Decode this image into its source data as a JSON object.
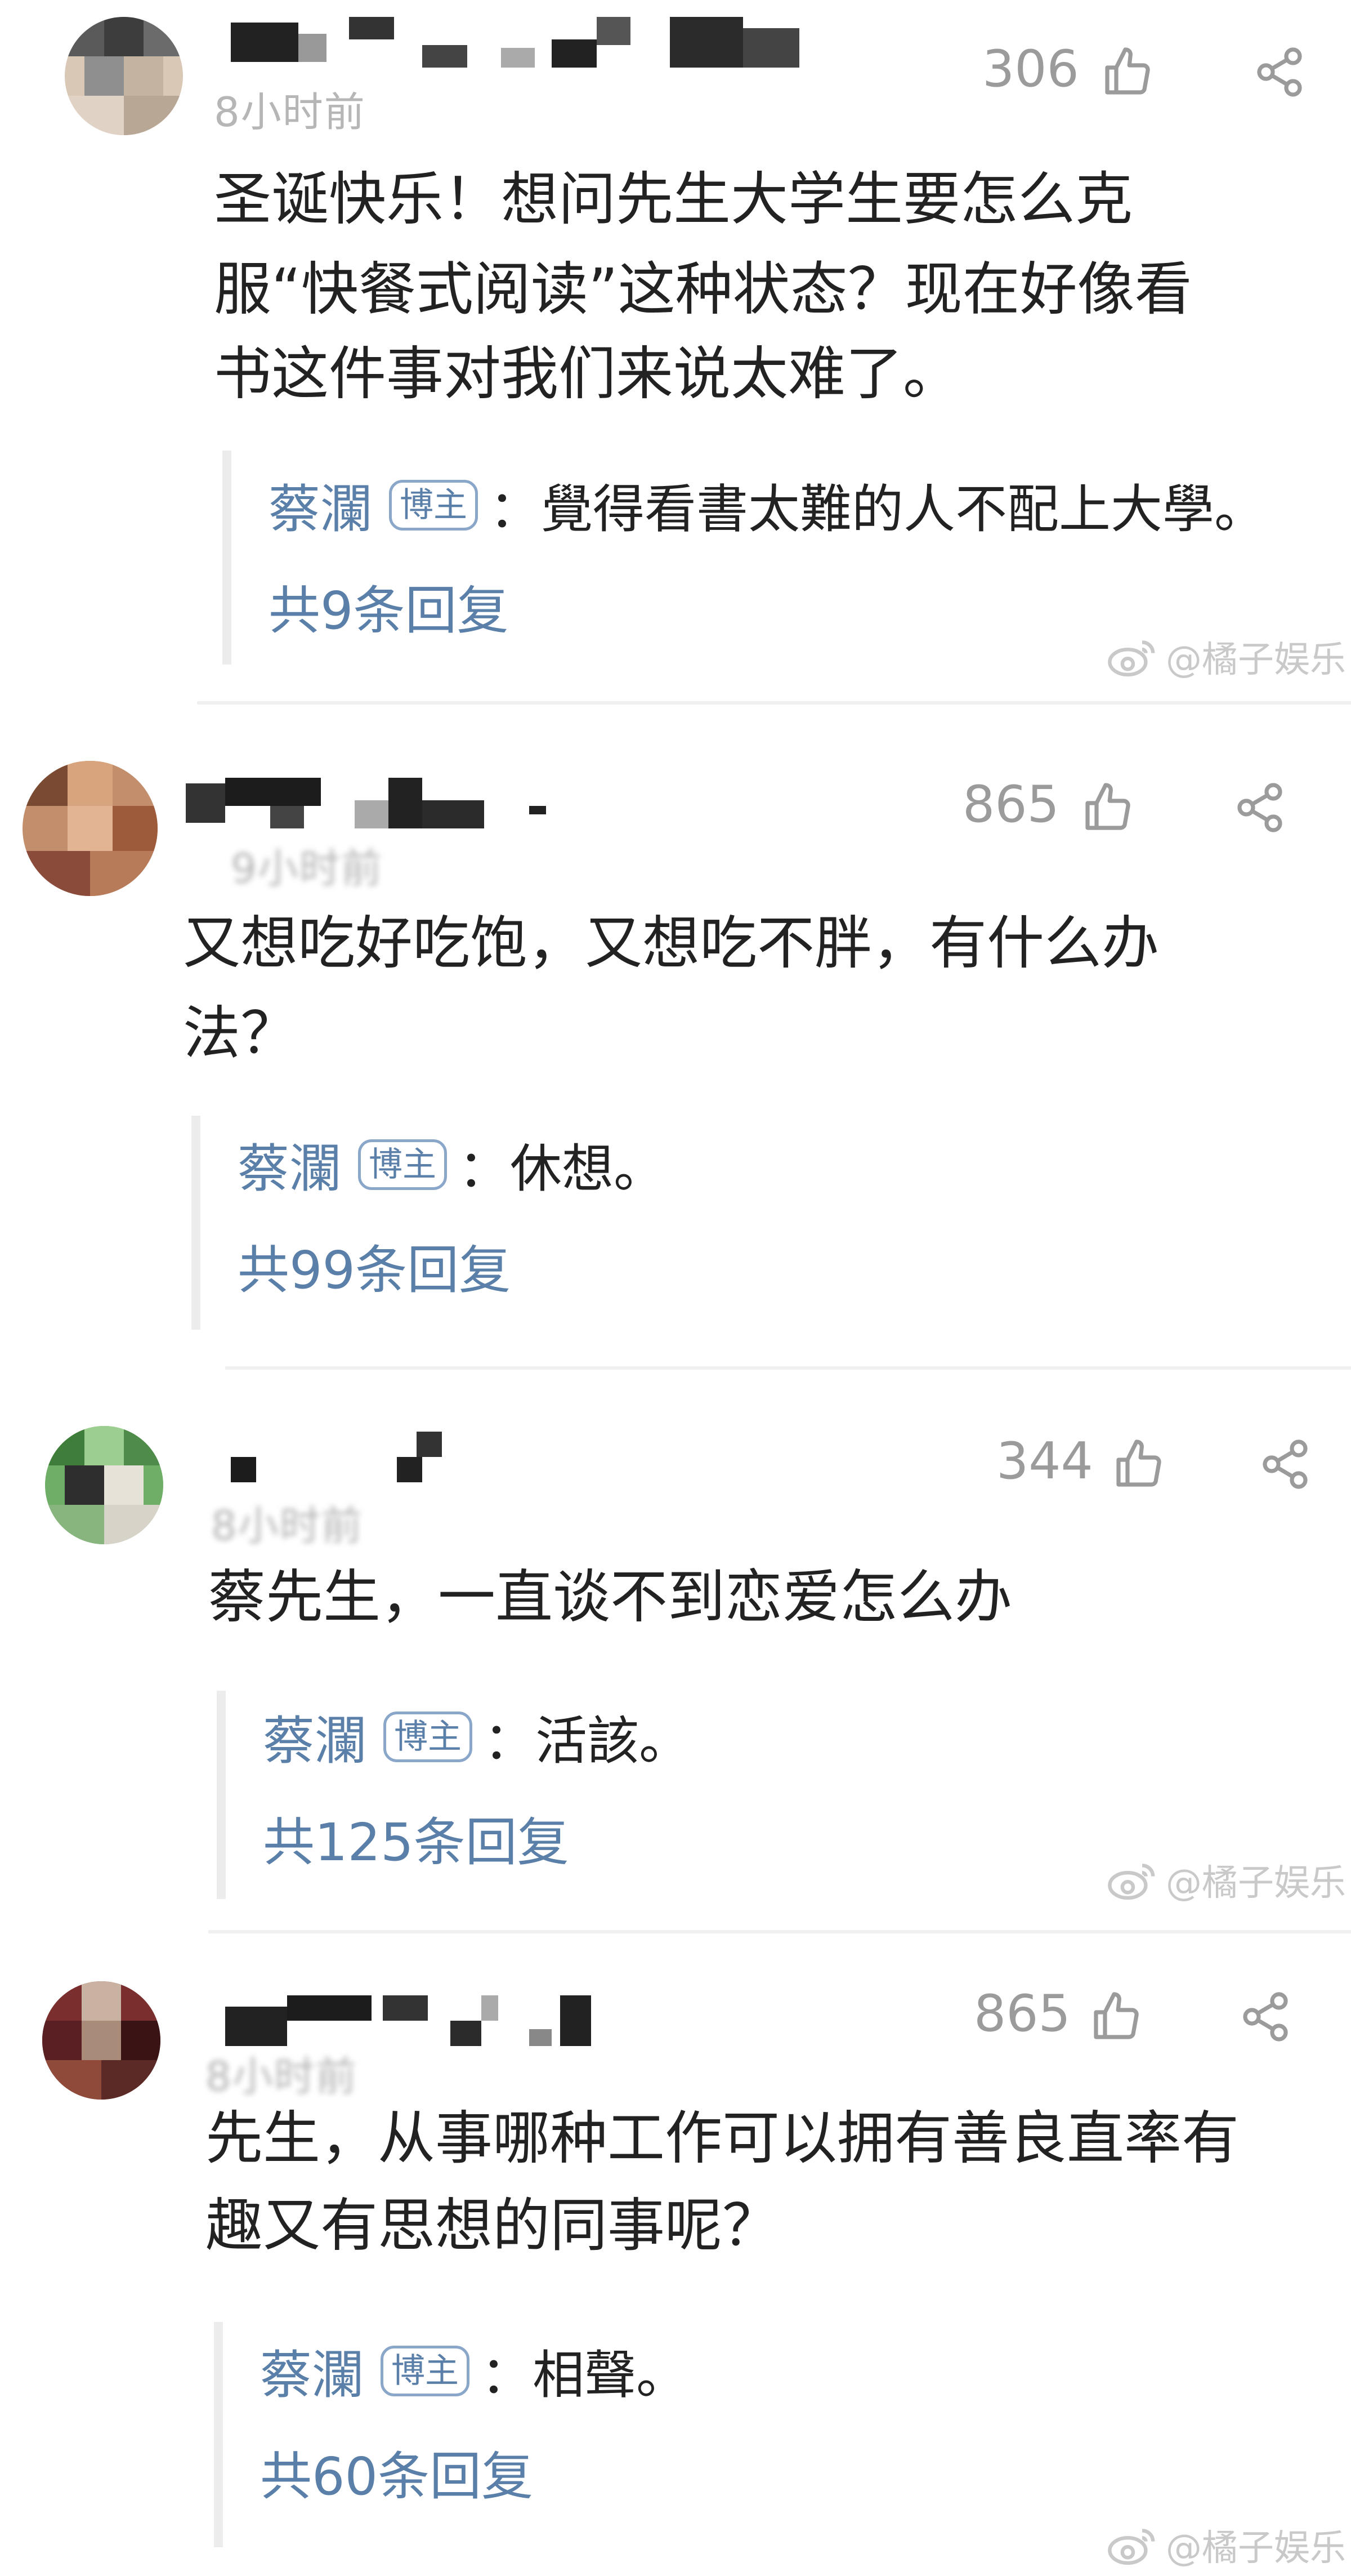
{
  "comments": [
    {
      "time": "8小时前",
      "likes": "306",
      "text_lines": [
        "圣诞快乐！想问先生大学生要怎么克",
        "服“快餐式阅读”这种状态？现在好像看",
        "书这件事对我们来说太难了。"
      ],
      "reply": {
        "author": "蔡瀾",
        "badge": "博主",
        "text": "：覺得看書太難的人不配上大學。",
        "count": "共9条回复"
      },
      "watermark": "@橘子娱乐"
    },
    {
      "time": "9小时前",
      "likes": "865",
      "text_lines": [
        "又想吃好吃饱，又想吃不胖，有什么办",
        "法？"
      ],
      "reply": {
        "author": "蔡瀾",
        "badge": "博主",
        "text": "：休想。",
        "count": "共99条回复"
      },
      "watermark": ""
    },
    {
      "time": "8小时前",
      "likes": "344",
      "text_lines": [
        "蔡先生，一直谈不到恋爱怎么办"
      ],
      "reply": {
        "author": "蔡瀾",
        "badge": "博主",
        "text": "：活該。",
        "count": "共125条回复"
      },
      "watermark": "@橘子娱乐"
    },
    {
      "time": "8小时前",
      "likes": "865",
      "text_lines": [
        "先生，从事哪种工作可以拥有善良直率有",
        "趣又有思想的同事呢？"
      ],
      "reply": {
        "author": "蔡瀾",
        "badge": "博主",
        "text": "：相聲。",
        "count": "共60条回复"
      },
      "watermark": "@橘子娱乐"
    }
  ],
  "icons": {
    "like": "thumbs-up-icon",
    "share": "share-icon",
    "weibo": "weibo-logo-icon"
  }
}
